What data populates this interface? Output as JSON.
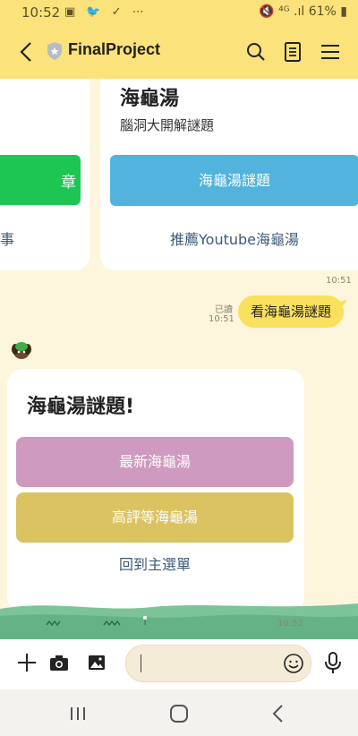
{
  "status_bar": {
    "time": "10:52",
    "notification_icons": "▣ 🐦 ✓  ⋯",
    "right_text": "🔇 ⁴ᴳ .ıl 61% ▮"
  },
  "app_bar": {
    "title": "FinalProject",
    "icons": [
      "back-arrow",
      "shield",
      "search",
      "notes",
      "menu"
    ]
  },
  "carousel": {
    "left_card": {
      "button_label_fragment": "章",
      "link_fragment": "事"
    },
    "right_card": {
      "title": "海龜湯",
      "subtitle": "腦洞大開解謎題",
      "button_label": "海龜湯謎題",
      "link_label": "推薦Youtube海龜湯"
    },
    "time": "10:51"
  },
  "user_message": {
    "read_label": "已讀",
    "time": "10:51",
    "text": "看海龜湯謎題"
  },
  "bot_card": {
    "title": "海龜湯謎題!",
    "buttons": [
      {
        "label": "最新海龜湯",
        "color": "#cf9abf"
      },
      {
        "label": "高評等海龜湯",
        "color": "#dbc361"
      }
    ],
    "link_label": "回到主選單",
    "time": "10:52"
  },
  "input_bar": {
    "icons": [
      "plus",
      "camera",
      "image",
      "emoji",
      "microphone"
    ],
    "placeholder": ""
  },
  "nav_bar": {
    "icons": [
      "recent-apps",
      "home",
      "back"
    ]
  },
  "colors": {
    "header": "#fbe27a",
    "chat_bg": "#fdf6dc",
    "green_btn": "#1dc653",
    "blue_btn": "#52b3dc",
    "user_bubble": "#f9e05d"
  }
}
